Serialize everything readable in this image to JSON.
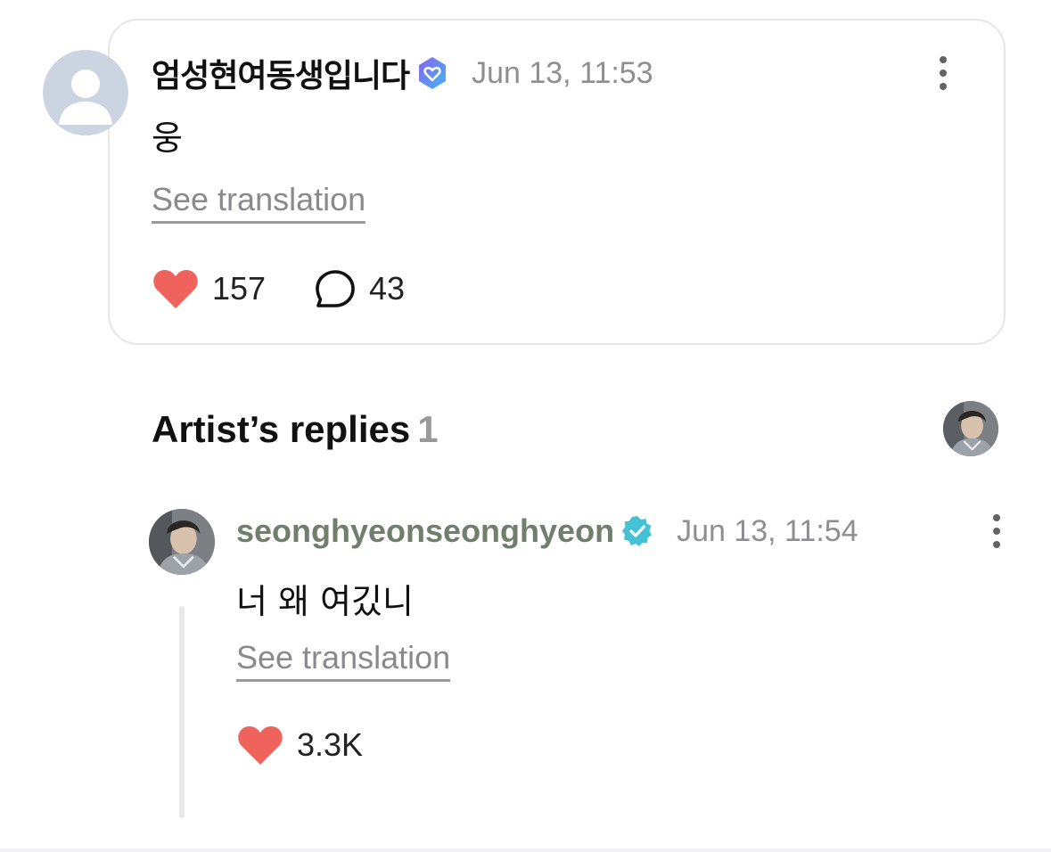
{
  "fan_comment": {
    "username": "엄성현여동생입니다",
    "verified_badge": "membership-heart-badge-icon",
    "timestamp": "Jun 13, 11:53",
    "body": "웅",
    "see_translation": "See translation",
    "likes": "157",
    "replies": "43"
  },
  "artist_replies": {
    "title": "Artist’s replies",
    "count": "1"
  },
  "artist_reply": {
    "username": "seonghyeonseonghyeon",
    "verified_badge": "artist-verified-badge-icon",
    "timestamp": "Jun 13, 11:54",
    "body": "너 왜 여깄니",
    "see_translation": "See translation",
    "likes": "3.3K"
  },
  "colors": {
    "heart": "#f0625c",
    "artist_name": "#6f7f6c",
    "artist_badge": "#45c1d6",
    "fan_badge_start": "#8a63f2",
    "fan_badge_end": "#3fb6f0",
    "muted_text": "#8e8e93"
  }
}
